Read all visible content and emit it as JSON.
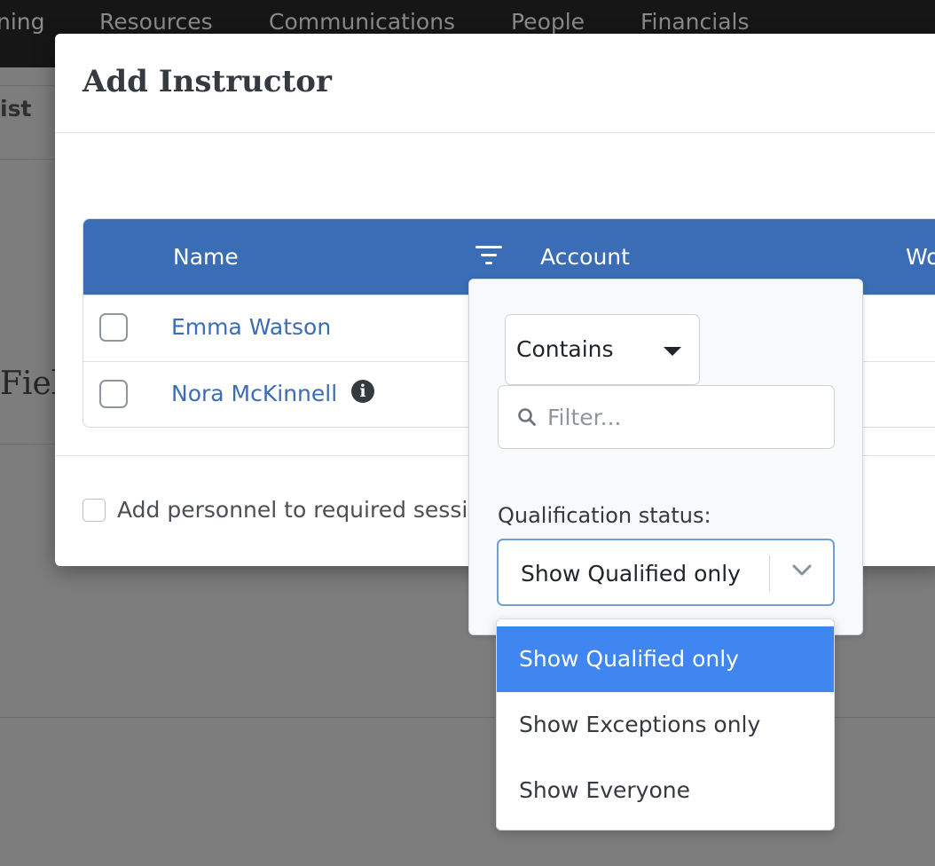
{
  "nav": {
    "items": [
      "ning",
      "Resources",
      "Communications",
      "People",
      "Financials"
    ]
  },
  "background": {
    "subbar_text": "ist",
    "heading_fragment": "Fiel"
  },
  "modal": {
    "title": "Add Instructor",
    "table": {
      "columns": [
        "Name",
        "Account",
        "Wo"
      ],
      "rows": [
        {
          "name": "Emma Watson",
          "info": false
        },
        {
          "name": "Nora McKinnell",
          "info": true
        }
      ]
    },
    "footer_checkbox_label": "Add personnel to required sessio"
  },
  "filter_popover": {
    "operator": "Contains",
    "filter_placeholder": "Filter...",
    "qualification_label": "Qualification status:",
    "qualification_value": "Show Qualified only",
    "options": [
      "Show Qualified only",
      "Show Exceptions only",
      "Show Everyone"
    ],
    "selected_option": "Show Qualified only"
  },
  "icons": {
    "filter": "filter-icon",
    "info": "info-icon",
    "search": "search-icon",
    "caret": "caret-down-icon",
    "chevron": "chevron-down-icon"
  },
  "colors": {
    "table_header": "#3a6db5",
    "link": "#3a6db5",
    "selected_option": "#3f86f0",
    "focus_border": "#6f9edb"
  }
}
